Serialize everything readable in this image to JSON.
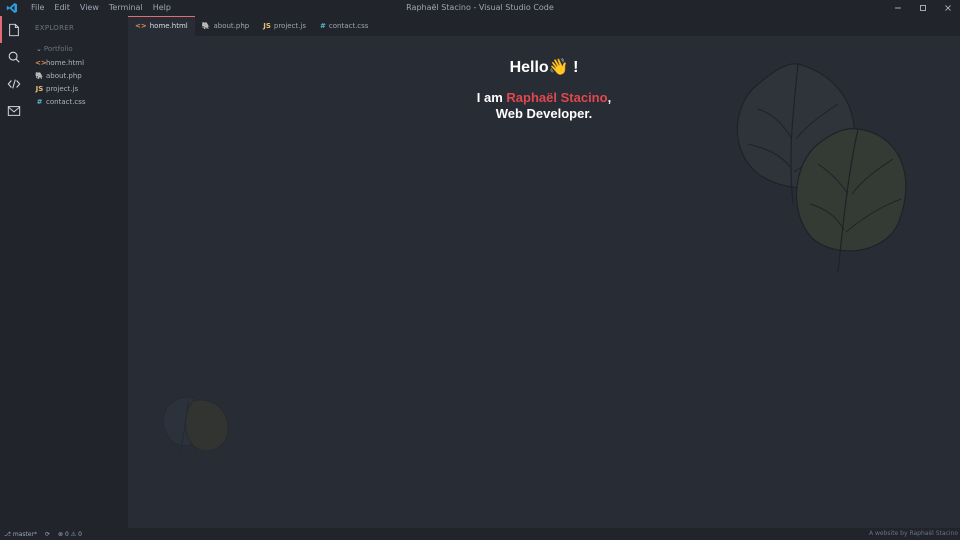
{
  "window": {
    "title": "Raphaël Stacino - Visual Studio Code",
    "menu": [
      "File",
      "Edit",
      "View",
      "Terminal",
      "Help"
    ]
  },
  "activity_bar": {
    "items": [
      {
        "icon": "files-icon",
        "active": true
      },
      {
        "icon": "search-icon",
        "active": false
      },
      {
        "icon": "code-icon",
        "active": false
      },
      {
        "icon": "mail-icon",
        "active": false
      }
    ]
  },
  "sidebar": {
    "title": "EXPLORER",
    "folder": "Portfolio",
    "files": [
      {
        "name": "home.html",
        "icon": "<>",
        "color": "#e5904f"
      },
      {
        "name": "about.php",
        "icon": "🐘",
        "color": "#a074c4"
      },
      {
        "name": "project.js",
        "icon": "JS",
        "color": "#e5c07b"
      },
      {
        "name": "contact.css",
        "icon": "#",
        "color": "#56b6c2"
      }
    ]
  },
  "tabs": [
    {
      "label": "home.html",
      "icon": "<>",
      "color": "#e5904f",
      "active": true
    },
    {
      "label": "about.php",
      "icon": "🐘",
      "color": "#a074c4",
      "active": false
    },
    {
      "label": "project.js",
      "icon": "JS",
      "color": "#e5c07b",
      "active": false
    },
    {
      "label": "contact.css",
      "icon": "#",
      "color": "#56b6c2",
      "active": false
    }
  ],
  "content": {
    "greeting": "Hello",
    "greeting_emoji": "👋",
    "greeting_suffix": " !",
    "intro_prefix": "I am ",
    "intro_name": "Raphaël Stacino",
    "intro_suffix": ",",
    "intro_line2": "Web Developer."
  },
  "statusbar": {
    "branch": "master*",
    "sync": "⟳",
    "errors": "0",
    "warnings": "0",
    "credit": "A website by Raphaël Stacino"
  },
  "colors": {
    "accent": "#e06c75",
    "name_highlight": "#e0484f",
    "background": "#282c34",
    "sidebar": "#21252b"
  }
}
